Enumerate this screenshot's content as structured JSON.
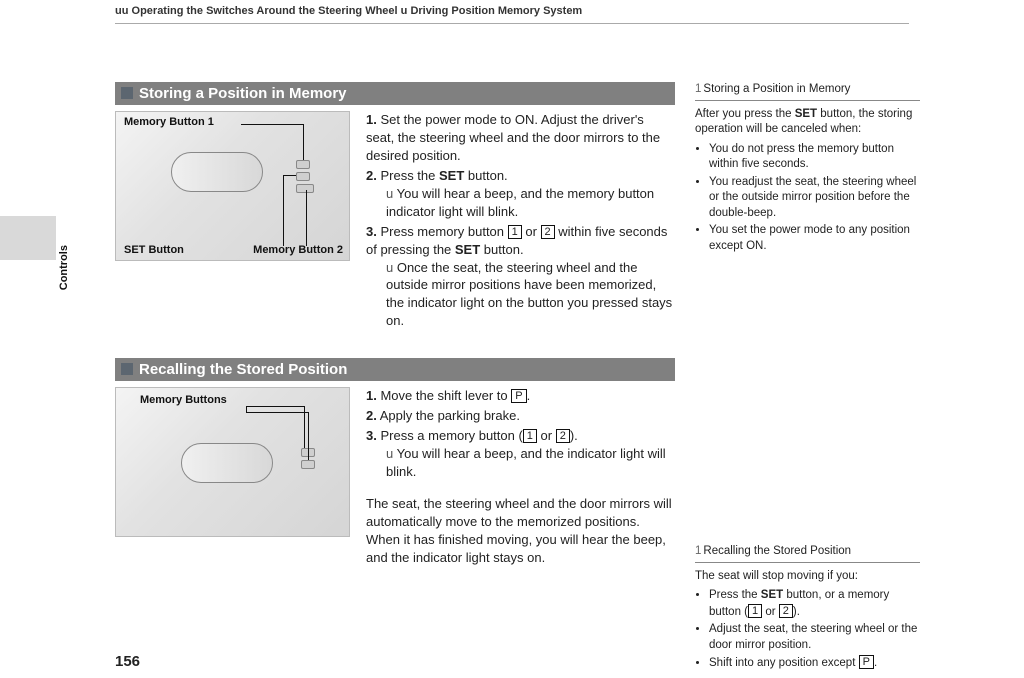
{
  "header": {
    "prefix": "uu",
    "part1": "Operating the Switches Around the Steering Wheel",
    "sep": "u",
    "part2": "Driving Position Memory System"
  },
  "side_tab_label": "Controls",
  "page_number": "156",
  "section1": {
    "heading": "Storing a Position in Memory",
    "fig": {
      "label1": "Memory Button 1",
      "label2": "SET Button",
      "label3": "Memory Button 2"
    },
    "steps": {
      "s1_num": "1.",
      "s1": "Set the power mode to ON. Adjust the driver's seat, the steering wheel and the door mirrors to the desired position.",
      "s2_num": "2.",
      "s2_a": "Press the ",
      "s2_b": "SET",
      "s2_c": " button.",
      "s2_sub": "You will hear a beep, and the memory button indicator light will blink.",
      "s3_num": "3.",
      "s3_a": "Press memory button ",
      "s3_b": "1",
      "s3_c": " or ",
      "s3_d": "2",
      "s3_e": " within five seconds of pressing the ",
      "s3_f": "SET",
      "s3_g": " button.",
      "s3_sub": "Once the seat, the steering wheel and the outside mirror positions have been memorized, the indicator light on the button you pressed stays on."
    }
  },
  "section2": {
    "heading": "Recalling the Stored Position",
    "fig": {
      "label1": "Memory Buttons"
    },
    "steps": {
      "s1_num": "1.",
      "s1_a": "Move the shift lever to ",
      "s1_b": "P",
      "s1_c": ".",
      "s2_num": "2.",
      "s2": "Apply the parking brake.",
      "s3_num": "3.",
      "s3_a": "Press a memory button (",
      "s3_b": "1",
      "s3_c": " or ",
      "s3_d": "2",
      "s3_e": ").",
      "s3_sub": "You will hear a beep, and the indicator light will blink.",
      "para": "The seat, the steering wheel and the door mirrors will automatically move to the memorized positions. When it has finished moving, you will hear the beep, and the indicator light stays on."
    }
  },
  "sidebar1": {
    "prefix": "1",
    "heading": "Storing a Position in Memory",
    "lead_a": "After you press the ",
    "lead_b": "SET",
    "lead_c": " button, the storing operation will be canceled when:",
    "items": [
      "You do not press the memory button within five seconds.",
      "You readjust the seat, the steering wheel or the outside mirror position before the double-beep.",
      "You set the power mode to any position except ON."
    ]
  },
  "sidebar2": {
    "prefix": "1",
    "heading": "Recalling the Stored Position",
    "lead": "The seat will stop moving if you:",
    "item1_a": "Press the ",
    "item1_b": "SET",
    "item1_c": " button, or a memory button (",
    "item1_d": "1",
    "item1_e": " or ",
    "item1_f": "2",
    "item1_g": ").",
    "item2": "Adjust the seat, the steering wheel or the door mirror position.",
    "item3_a": "Shift into any position except ",
    "item3_b": "P",
    "item3_c": "."
  }
}
